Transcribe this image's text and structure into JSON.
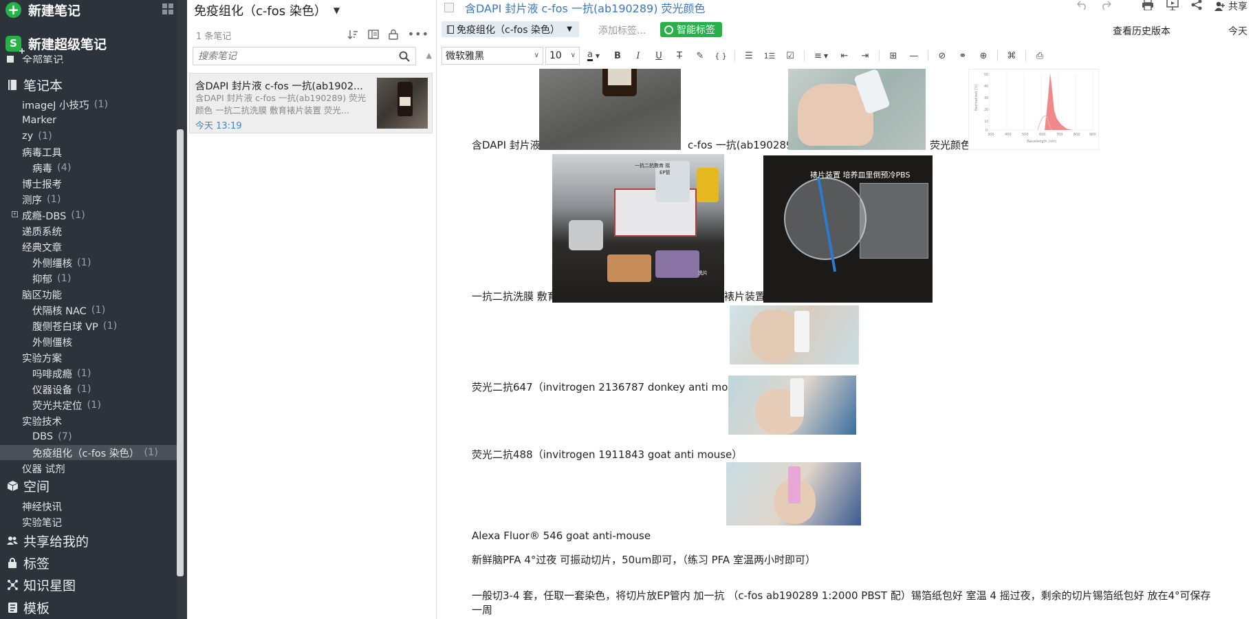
{
  "sidebar": {
    "new_note": "新建笔记",
    "new_super_note": "新建超级笔记",
    "all_notes": "全部笔记",
    "notebooks_label": "笔记本",
    "notebooks": [
      {
        "label": "imageJ 小技巧",
        "count": "(1)",
        "indent": 1
      },
      {
        "label": "Marker",
        "count": "",
        "indent": 1
      },
      {
        "label": "zy",
        "count": "(1)",
        "indent": 1
      },
      {
        "label": "病毒工具",
        "count": "",
        "indent": 1
      },
      {
        "label": "病毒",
        "count": "(4)",
        "indent": 2
      },
      {
        "label": "博士报考",
        "count": "",
        "indent": 1
      },
      {
        "label": "测序",
        "count": "(1)",
        "indent": 1
      },
      {
        "label": "成瘾-DBS",
        "count": "(1)",
        "indent": 1,
        "boxed": true
      },
      {
        "label": "递质系统",
        "count": "",
        "indent": 1
      },
      {
        "label": "经典文章",
        "count": "",
        "indent": 1
      },
      {
        "label": "外侧缰核",
        "count": "(1)",
        "indent": 2
      },
      {
        "label": "抑郁",
        "count": "(1)",
        "indent": 2
      },
      {
        "label": "脑区功能",
        "count": "",
        "indent": 1
      },
      {
        "label": "伏隔核 NAC",
        "count": "(1)",
        "indent": 2
      },
      {
        "label": "腹侧苍白球 VP",
        "count": "(1)",
        "indent": 2
      },
      {
        "label": "外侧僵核",
        "count": "",
        "indent": 2
      },
      {
        "label": "实验方案",
        "count": "",
        "indent": 1
      },
      {
        "label": "吗啡成瘾",
        "count": "(1)",
        "indent": 2
      },
      {
        "label": "仪器设备",
        "count": "(1)",
        "indent": 2
      },
      {
        "label": "荧光共定位",
        "count": "(1)",
        "indent": 2
      },
      {
        "label": "实验技术",
        "count": "",
        "indent": 1
      },
      {
        "label": "DBS",
        "count": "(7)",
        "indent": 2
      },
      {
        "label": "免疫组化（c-fos 染色）",
        "count": "(1)",
        "indent": 2,
        "selected": true
      },
      {
        "label": "仪器 试剂",
        "count": "",
        "indent": 1
      }
    ],
    "space_label": "空间",
    "spaces": [
      "神经快讯",
      "实验笔记"
    ],
    "shared_label": "共享给我的",
    "tags_label": "标签",
    "graph_label": "知识星图",
    "templates_label": "模板"
  },
  "note_list": {
    "title": "免疫组化（c-fos 染色）",
    "count": "1 条笔记",
    "search_placeholder": "搜索笔记",
    "notes": [
      {
        "title": "含DAPI 封片液 c-fos 一抗(ab1902...",
        "snippet": "含DAPI 封片液 c-fos 一抗(ab190289) 荧光颜色 一抗二抗洗膜 敷育裱片装置 荧光...",
        "date": "今天 13:19"
      }
    ]
  },
  "editor": {
    "title": "含DAPI 封片液 c-fos 一抗(ab190289) 荧光颜色",
    "notebook_chip": "免疫组化（c-fos 染色）",
    "add_tag": "添加标签...",
    "smart_tag": "智能标签",
    "history": "查看历史版本",
    "today": "今天",
    "share": "共享",
    "font": "微软雅黑",
    "size": "10",
    "captions": {
      "c1": "含DAPI 封片液",
      "c2": "c-fos 一抗(ab190289)",
      "c3": "荧光颜色",
      "c4": "一抗二抗洗膜 敷育",
      "c5": "裱片装置",
      "c6": "荧光二抗647（invitrogen 2136787 donkey anti mouse）",
      "c7": "荧光二抗488（invitrogen 1911843 goat anti mouse）",
      "c8": "Alexa Fluor® 546 goat anti-mouse"
    },
    "paragraphs": [
      "新鲜脑PFA 4°过夜 可振动切片，50um即可，（练习 PFA 室温两小时即可）",
      "一般切3-4 套，任取一套染色，将切片放EP管内 加一抗 （c-fos ab190289 1:2000 PBST 配）锡箔纸包好 室温 4 摇过夜，剩余的切片锡箔纸包好 放在4°可保存",
      "一周"
    ],
    "photo_labels": {
      "p5_top": "一抗二抗敷育 摇",
      "p5_sub": "EP管",
      "p5_tag": "洗片",
      "p6_top": "裱片装置  培养皿里倒预冷PBS"
    },
    "chart_axis": {
      "xlabel": "Wavelength (nm)",
      "ylabel": "Normalized (%)",
      "ticks": [
        "300",
        "400",
        "500",
        "600",
        "700",
        "800",
        "900"
      ],
      "y_ticks": [
        "50",
        "40",
        "30",
        "20",
        "10",
        "0"
      ]
    }
  },
  "colors": {
    "sidebar_bg": "#2c333b",
    "accent_green": "#27b148",
    "link_blue": "#3677c2",
    "spectrum_red": "#f08a8a"
  }
}
